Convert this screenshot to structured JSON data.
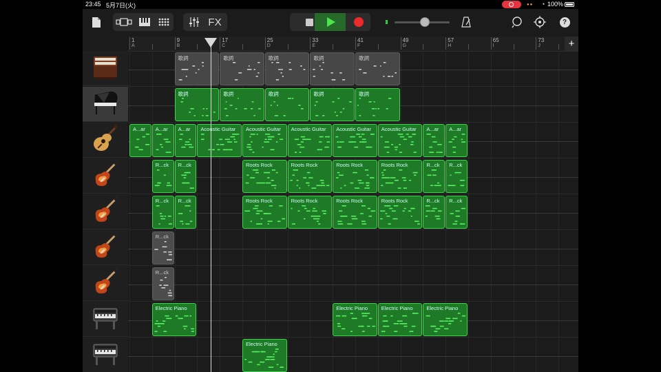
{
  "status_bar": {
    "time": "23:45",
    "date": "5月7日(火)",
    "battery": "100%"
  },
  "toolbar": {
    "fx_label": "FX",
    "icons": [
      "document-icon",
      "track-view-icon",
      "keyboard-icon",
      "grid-icon",
      "mixer-icon",
      "stop-icon",
      "play-icon",
      "record-icon",
      "metronome-icon",
      "loop-icon",
      "settings-icon",
      "help-icon"
    ],
    "help_label": "?",
    "volume": 0.55,
    "accent_play": "#266a2a",
    "accent_record": "#ee2b2b"
  },
  "ruler": {
    "bars": [
      {
        "num": "1",
        "letter": "A"
      },
      {
        "num": "9",
        "letter": "B"
      },
      {
        "num": "17",
        "letter": "C"
      },
      {
        "num": "25",
        "letter": "D"
      },
      {
        "num": "33",
        "letter": "E"
      },
      {
        "num": "41",
        "letter": "F"
      },
      {
        "num": "49",
        "letter": "G"
      },
      {
        "num": "57",
        "letter": "H"
      },
      {
        "num": "65",
        "letter": "I"
      },
      {
        "num": "73",
        "letter": "J"
      }
    ],
    "add_label": "+"
  },
  "tracks": [
    {
      "instrument": "organ",
      "icon": "organ-icon",
      "selected": false,
      "regions": [
        {
          "label": "歌詞",
          "start": 2,
          "len": 2,
          "style": "gray"
        },
        {
          "label": "歌詞",
          "start": 4,
          "len": 2,
          "style": "gray"
        },
        {
          "label": "歌詞",
          "start": 6,
          "len": 2,
          "style": "gray"
        },
        {
          "label": "歌詞",
          "start": 8,
          "len": 2,
          "style": "gray"
        },
        {
          "label": "歌詞",
          "start": 10,
          "len": 2,
          "style": "gray"
        }
      ]
    },
    {
      "instrument": "grand piano",
      "icon": "grand-piano-icon",
      "selected": true,
      "regions": [
        {
          "label": "歌詞",
          "start": 2,
          "len": 2,
          "style": "green"
        },
        {
          "label": "歌詞",
          "start": 4,
          "len": 2,
          "style": "green"
        },
        {
          "label": "歌詞",
          "start": 6,
          "len": 2,
          "style": "green"
        },
        {
          "label": "歌詞",
          "start": 8,
          "len": 2,
          "style": "green"
        },
        {
          "label": "歌詞",
          "start": 10,
          "len": 2,
          "style": "green"
        }
      ]
    },
    {
      "instrument": "acoustic guitar",
      "icon": "acoustic-guitar-icon",
      "selected": false,
      "regions": [
        {
          "label": "A...ar",
          "start": 0,
          "len": 1,
          "style": "green"
        },
        {
          "label": "A...ar",
          "start": 1,
          "len": 1,
          "style": "green"
        },
        {
          "label": "A...ar",
          "start": 2,
          "len": 1,
          "style": "green"
        },
        {
          "label": "Acoustic Guitar",
          "start": 3,
          "len": 2,
          "style": "green"
        },
        {
          "label": "Acoustic Guitar",
          "start": 5,
          "len": 2,
          "style": "green"
        },
        {
          "label": "Acoustic Guitar",
          "start": 7,
          "len": 2,
          "style": "green"
        },
        {
          "label": "Acoustic Guitar",
          "start": 9,
          "len": 2,
          "style": "green"
        },
        {
          "label": "Acoustic Guitar",
          "start": 11,
          "len": 2,
          "style": "green"
        },
        {
          "label": "A...ar",
          "start": 13,
          "len": 1,
          "style": "green"
        },
        {
          "label": "A...ar",
          "start": 14,
          "len": 1,
          "style": "green"
        }
      ]
    },
    {
      "instrument": "electric guitar",
      "icon": "electric-guitar-icon",
      "selected": false,
      "regions": [
        {
          "label": "R...ck",
          "start": 1,
          "len": 1,
          "style": "green"
        },
        {
          "label": "R...ck",
          "start": 2,
          "len": 1,
          "style": "green"
        },
        {
          "label": "Roots Rock",
          "start": 5,
          "len": 2,
          "style": "green"
        },
        {
          "label": "Roots Rock",
          "start": 7,
          "len": 2,
          "style": "green"
        },
        {
          "label": "Roots Rock",
          "start": 9,
          "len": 2,
          "style": "green"
        },
        {
          "label": "Roots Rock",
          "start": 11,
          "len": 2,
          "style": "green"
        },
        {
          "label": "R...ck",
          "start": 13,
          "len": 1,
          "style": "green"
        },
        {
          "label": "R...ck",
          "start": 14,
          "len": 1,
          "style": "green"
        }
      ]
    },
    {
      "instrument": "electric guitar",
      "icon": "electric-guitar-icon",
      "selected": false,
      "regions": [
        {
          "label": "R...ck",
          "start": 1,
          "len": 1,
          "style": "green"
        },
        {
          "label": "R...ck",
          "start": 2,
          "len": 1,
          "style": "green"
        },
        {
          "label": "Roots Rock",
          "start": 5,
          "len": 2,
          "style": "green"
        },
        {
          "label": "Roots Rock",
          "start": 7,
          "len": 2,
          "style": "green"
        },
        {
          "label": "Roots Rock",
          "start": 9,
          "len": 2,
          "style": "green"
        },
        {
          "label": "Roots Rock",
          "start": 11,
          "len": 2,
          "style": "green"
        },
        {
          "label": "R...ck",
          "start": 13,
          "len": 1,
          "style": "green"
        },
        {
          "label": "R...ck",
          "start": 14,
          "len": 1,
          "style": "green"
        }
      ]
    },
    {
      "instrument": "electric guitar",
      "icon": "electric-guitar-icon",
      "selected": false,
      "regions": [
        {
          "label": "R...ck",
          "start": 1,
          "len": 1,
          "style": "dgray"
        }
      ]
    },
    {
      "instrument": "electric guitar",
      "icon": "electric-guitar-icon",
      "selected": false,
      "regions": [
        {
          "label": "R...ck",
          "start": 1,
          "len": 1,
          "style": "dgray"
        }
      ]
    },
    {
      "instrument": "electric piano",
      "icon": "electric-piano-icon",
      "selected": false,
      "regions": [
        {
          "label": "Electric Piano",
          "start": 1,
          "len": 2,
          "style": "green"
        },
        {
          "label": "Electric Piano",
          "start": 9,
          "len": 2,
          "style": "green"
        },
        {
          "label": "Electric Piano",
          "start": 11,
          "len": 2,
          "style": "green"
        },
        {
          "label": "Electric Piano",
          "start": 13,
          "len": 2,
          "style": "green"
        }
      ]
    },
    {
      "instrument": "electric piano",
      "icon": "electric-piano-icon",
      "selected": false,
      "regions": [
        {
          "label": "Electric Piano",
          "start": 5,
          "len": 2,
          "style": "green"
        }
      ]
    }
  ],
  "playhead_bar": 15.4
}
